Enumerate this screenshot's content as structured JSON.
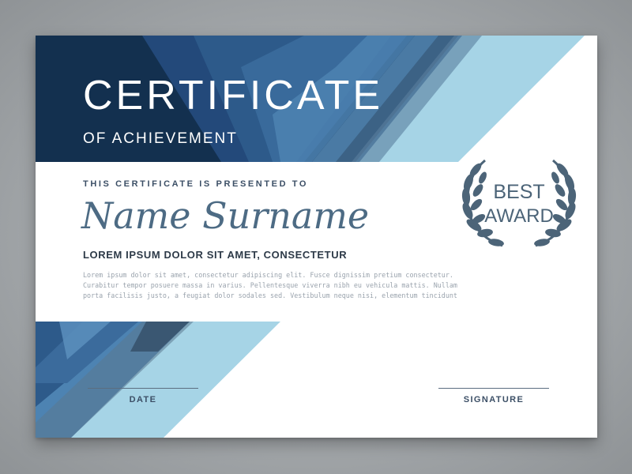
{
  "certificate": {
    "title": "CERTIFICATE",
    "subtitle": "OF ACHIEVEMENT",
    "presented_to": "THIS CERTIFICATE IS PRESENTED TO",
    "recipient_name": "Name Surname",
    "tagline": "LOREM IPSUM DOLOR SIT AMET, CONSECTETUR",
    "body_lines": [
      "Lorem ipsum dolor sit amet, consectetur adipiscing elit. Fusce dignissim pretium consectetur.",
      "Curabitur tempor posuere massa in varius. Pellentesque viverra nibh eu vehicula mattis. Nullam",
      "porta facilisis justo, a feugiat dolor sodales sed. Vestibulum neque nisi, elementum tincidunt"
    ],
    "badge": {
      "line1": "BEST",
      "line2": "AWARD",
      "icon": "laurel-wreath"
    },
    "date_label": "DATE",
    "signature_label": "SIGNATURE"
  },
  "colors": {
    "navy": "#13304f",
    "blue": "#2d5a8a",
    "mid_blue": "#4d83b2",
    "light_blue": "#a6d4e6",
    "slate": "#5b6d80",
    "name": "#4d6b84"
  }
}
